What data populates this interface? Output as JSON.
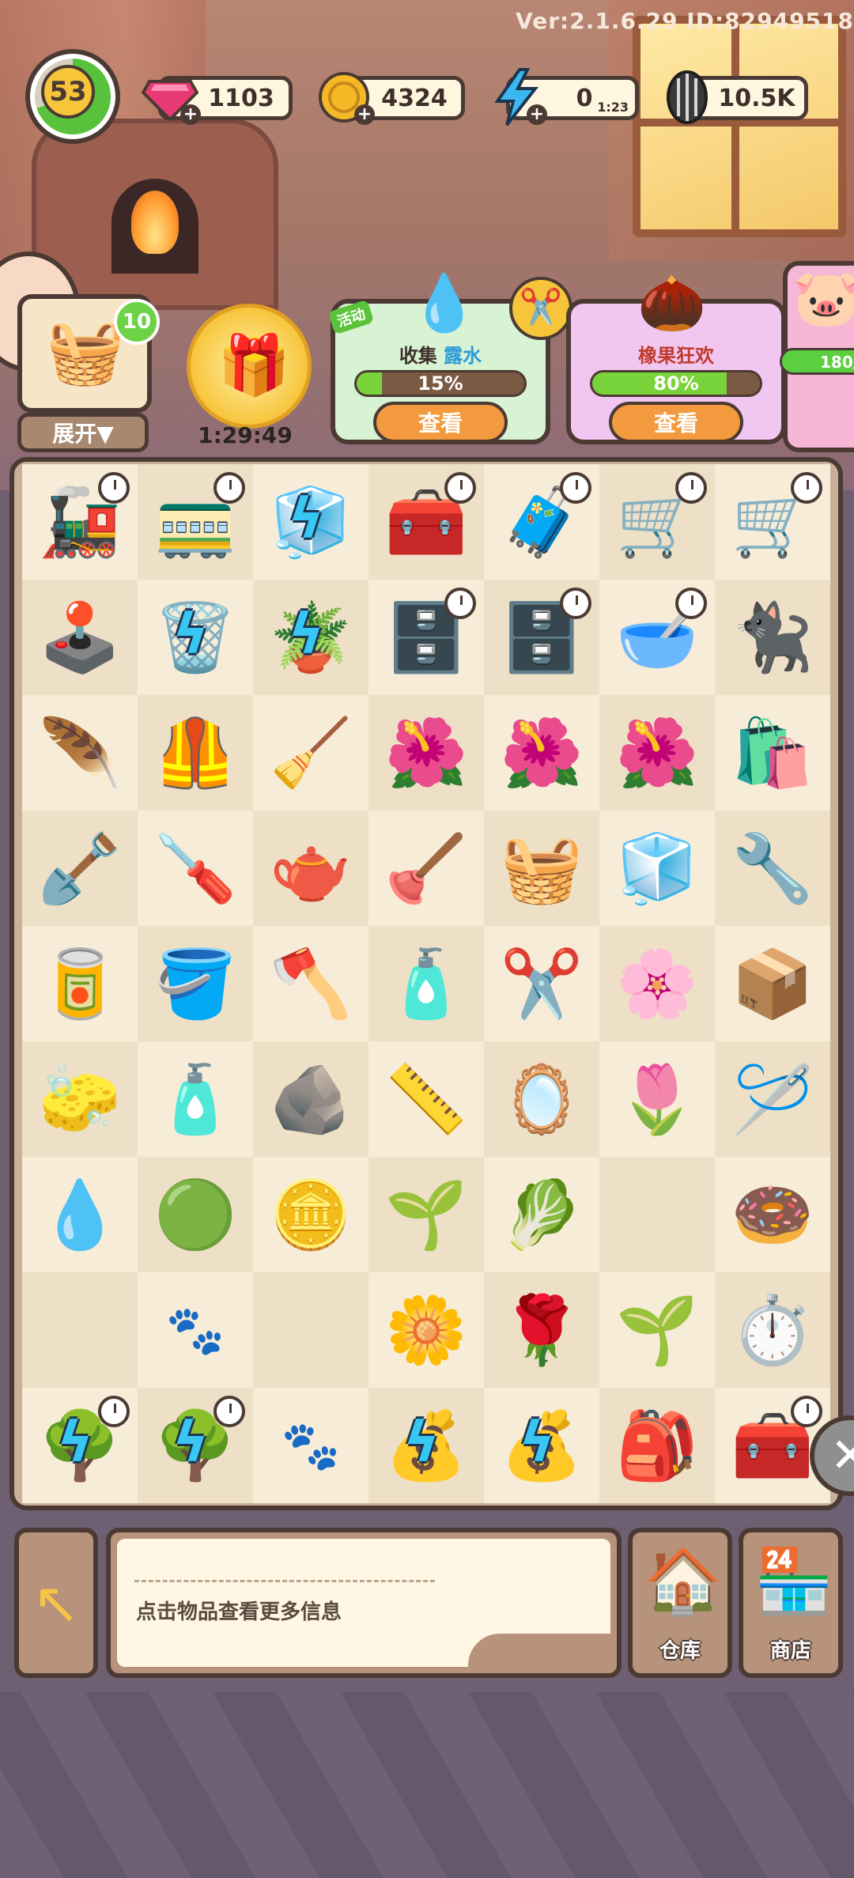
{
  "version_text": "Ver:2.1.6.29 ID:82949518",
  "player": {
    "level": "53"
  },
  "resources": {
    "gems": {
      "value": "1103",
      "icon": "gem-icon"
    },
    "coins": {
      "value": "4324",
      "icon": "coin-icon"
    },
    "energy": {
      "value": "0",
      "timer": "1:23",
      "icon": "lightning-icon"
    },
    "seeds": {
      "value": "10.5K",
      "icon": "sunflower-seed-icon"
    }
  },
  "side": {
    "pack_badge": "10",
    "expand_label": "展开▼",
    "gift_timer": "1:29:49"
  },
  "events": [
    {
      "badge": "活动",
      "title_prefix": "收集",
      "title_highlight": "露水",
      "progress": "15%",
      "progress_fraction": 0.15,
      "button": "查看"
    },
    {
      "title_prefix": "橡果狂欢",
      "title_highlight": "",
      "progress": "80%",
      "progress_fraction": 0.8,
      "button": "查看"
    }
  ],
  "piggy_bank": {
    "progress": "180/"
  },
  "board": {
    "rows": [
      [
        "🚂",
        "🚃",
        "🧊",
        "🧰",
        "🧳",
        "🛒",
        "🛒"
      ],
      [
        "🕹️",
        "🗑️",
        "🪴",
        "🗄️",
        "🗄️",
        "🥣",
        "🐈‍⬛"
      ],
      [
        "🪶",
        "🦺",
        "🧹",
        "🌺",
        "🌺",
        "🌺",
        "🛍️"
      ],
      [
        "🪏",
        "🪛",
        "🫖",
        "🪠",
        "🧺",
        "🧊",
        "🔧"
      ],
      [
        "🥫",
        "🪣",
        "🪓",
        "🧴",
        "✂️",
        "🌸",
        "📦"
      ],
      [
        "🧽",
        "🧴",
        "🪨",
        "📏",
        "🪞",
        "🌷",
        "🪡"
      ],
      [
        "💧",
        "🟢",
        "🪙",
        "🌱",
        "🥬",
        "",
        "🍩"
      ],
      [
        "",
        "",
        "",
        "🌼",
        "🌹",
        "🌱",
        "⏱️"
      ],
      [
        "🌳",
        "🌳",
        "",
        "💰",
        "💰",
        "🎒",
        "🧰"
      ]
    ],
    "clocks": [
      [
        0,
        0
      ],
      [
        0,
        1
      ],
      [
        0,
        3
      ],
      [
        0,
        4
      ],
      [
        0,
        5
      ],
      [
        0,
        6
      ],
      [
        1,
        3
      ],
      [
        1,
        4
      ],
      [
        1,
        5
      ],
      [
        8,
        0
      ],
      [
        8,
        1
      ],
      [
        8,
        6
      ]
    ],
    "bolts": [
      [
        0,
        2
      ],
      [
        1,
        1
      ],
      [
        1,
        2
      ],
      [
        8,
        0
      ],
      [
        8,
        1
      ],
      [
        8,
        3
      ],
      [
        8,
        4
      ]
    ],
    "paws": [
      [
        7,
        1
      ],
      [
        8,
        2
      ]
    ]
  },
  "bottom": {
    "info_text": "点击物品查看更多信息",
    "warehouse_label": "仓库",
    "shop_label": "商店"
  },
  "colors": {
    "accent_green": "#79d33a",
    "button_orange": "#f29a3d",
    "outline": "#4b3a33"
  }
}
